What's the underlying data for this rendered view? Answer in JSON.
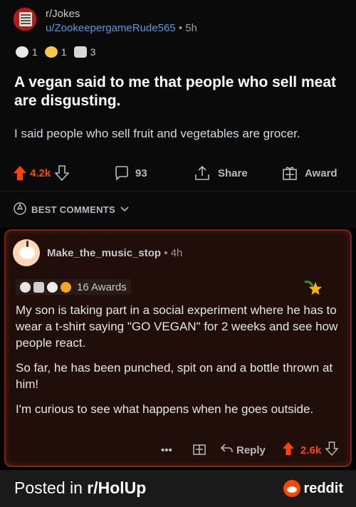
{
  "post": {
    "subreddit": "r/Jokes",
    "username": "u/ZookeepergameRude565",
    "separator": "•",
    "age": "5h",
    "awards": [
      {
        "icon": "helpful-award-icon",
        "count": "1"
      },
      {
        "icon": "wholesome-award-icon",
        "count": "1"
      },
      {
        "icon": "hugz-award-icon",
        "count": "3"
      }
    ],
    "title": "A vegan said to me that people who sell meat are disgusting.",
    "body": "I said people who sell fruit and vegetables are grocer.",
    "votes": "4.2k",
    "comments": "93",
    "share_label": "Share",
    "award_label": "Award"
  },
  "sort": {
    "label": "BEST COMMENTS"
  },
  "comment": {
    "username": "Make_the_music_stop",
    "separator": "•",
    "age": "4h",
    "awards_label": "16 Awards",
    "paragraphs": [
      "My son is taking part in a social experiment where he has to wear a t-shirt saying \"GO VEGAN\" for 2 weeks and see how people react.",
      "So far, he has been punched, spit on and a bottle thrown at him!",
      "I'm curious to see what happens when he goes outside."
    ],
    "more_label": "•••",
    "reply_label": "Reply",
    "votes": "2.6k"
  },
  "footer": {
    "posted_prefix": "Posted in ",
    "posted_sub": "r/HolUp",
    "brand": "reddit"
  },
  "colors": {
    "upvote": "#ff4500",
    "link": "#4f9ae0",
    "comment_border": "#7a2418"
  }
}
